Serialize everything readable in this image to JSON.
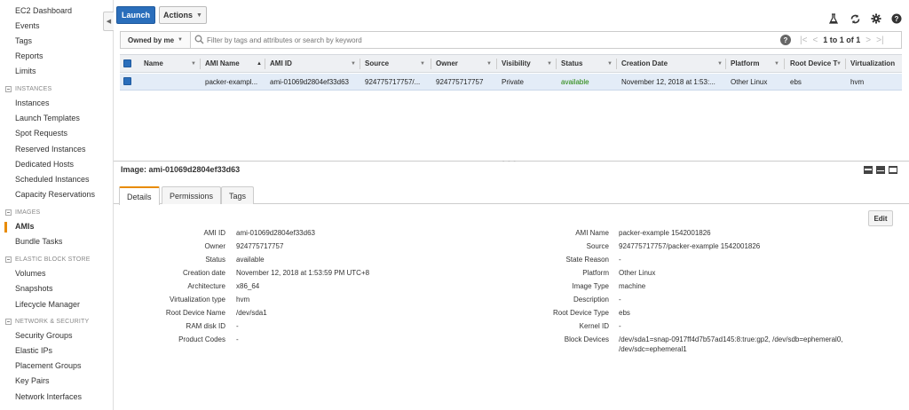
{
  "sidebar": {
    "top_items": [
      "EC2 Dashboard",
      "Events",
      "Tags",
      "Reports",
      "Limits"
    ],
    "sections": [
      {
        "title": "INSTANCES",
        "items": [
          "Instances",
          "Launch Templates",
          "Spot Requests",
          "Reserved Instances",
          "Dedicated Hosts",
          "Scheduled Instances",
          "Capacity Reservations"
        ]
      },
      {
        "title": "IMAGES",
        "items": [
          "AMIs",
          "Bundle Tasks"
        ]
      },
      {
        "title": "ELASTIC BLOCK STORE",
        "items": [
          "Volumes",
          "Snapshots",
          "Lifecycle Manager"
        ]
      },
      {
        "title": "NETWORK & SECURITY",
        "items": [
          "Security Groups",
          "Elastic IPs",
          "Placement Groups",
          "Key Pairs",
          "Network Interfaces"
        ]
      }
    ],
    "active_item": "AMIs",
    "active_color": "#e88b00"
  },
  "toolbar": {
    "launch_label": "Launch",
    "actions_label": "Actions",
    "icons": [
      "flask-icon",
      "refresh-icon",
      "gear-icon",
      "help-icon"
    ]
  },
  "filter": {
    "owned_label": "Owned by me",
    "placeholder": "Filter by tags and attributes or search by keyword",
    "pagination": "1 to 1 of 1"
  },
  "table": {
    "columns": [
      "Name",
      "AMI Name",
      "AMI ID",
      "Source",
      "Owner",
      "Visibility",
      "Status",
      "Creation Date",
      "Platform",
      "Root Device T",
      "Virtualization"
    ],
    "rows": [
      {
        "name": "",
        "ami_name": "packer-exampl...",
        "ami_id": "ami-01069d2804ef33d63",
        "source": "924775717757/...",
        "owner": "924775717757",
        "visibility": "Private",
        "status": "available",
        "creation_date": "November 12, 2018 at 1:53:...",
        "platform": "Other Linux",
        "root_device_type": "ebs",
        "virtualization": "hvm"
      }
    ]
  },
  "details": {
    "title": "Image: ami-01069d2804ef33d63",
    "tabs": [
      "Details",
      "Permissions",
      "Tags"
    ],
    "edit_label": "Edit",
    "left": [
      {
        "label": "AMI ID",
        "value": "ami-01069d2804ef33d63"
      },
      {
        "label": "Owner",
        "value": "924775717757"
      },
      {
        "label": "Status",
        "value": "available"
      },
      {
        "label": "Creation date",
        "value": "November 12, 2018 at 1:53:59 PM UTC+8"
      },
      {
        "label": "Architecture",
        "value": "x86_64"
      },
      {
        "label": "Virtualization type",
        "value": "hvm"
      },
      {
        "label": "Root Device Name",
        "value": "/dev/sda1"
      },
      {
        "label": "RAM disk ID",
        "value": "-"
      },
      {
        "label": "Product Codes",
        "value": "-"
      }
    ],
    "right": [
      {
        "label": "AMI Name",
        "value": "packer-example 1542001826"
      },
      {
        "label": "Source",
        "value": "924775717757/packer-example 1542001826"
      },
      {
        "label": "State Reason",
        "value": "-"
      },
      {
        "label": "Platform",
        "value": "Other Linux"
      },
      {
        "label": "Image Type",
        "value": "machine"
      },
      {
        "label": "Description",
        "value": "-"
      },
      {
        "label": "Root Device Type",
        "value": "ebs"
      },
      {
        "label": "Kernel ID",
        "value": "-"
      },
      {
        "label": "Block Devices",
        "value": "/dev/sda1=snap-0917ff4d7b57ad145:8:true:gp2, /dev/sdb=ephemeral0, /dev/sdc=ephemeral1"
      }
    ]
  },
  "colors": {
    "primary": "#2a6ebb",
    "status_available": "#1d8102",
    "selected_row": "#e3ecf7"
  }
}
